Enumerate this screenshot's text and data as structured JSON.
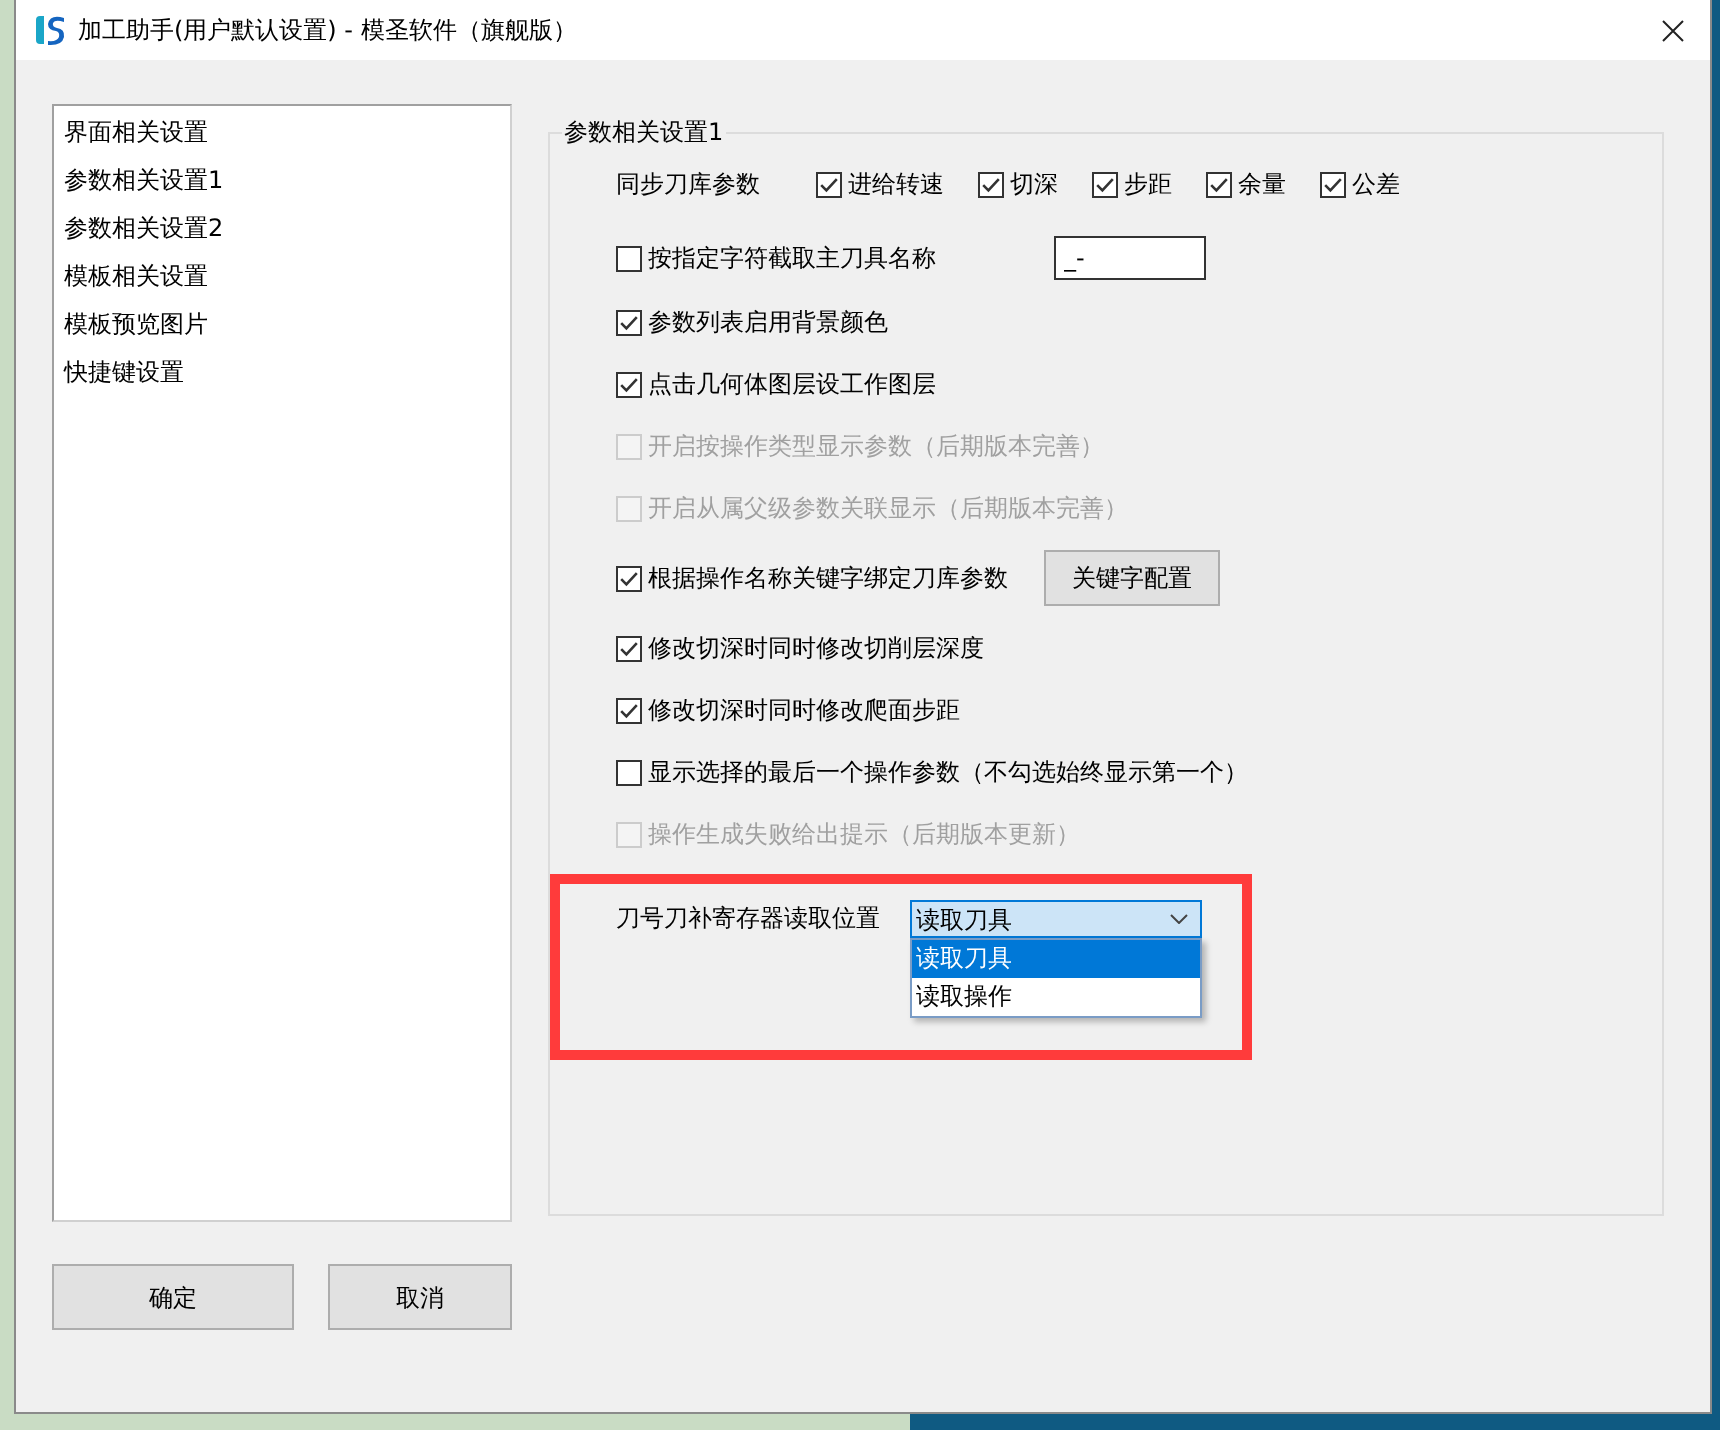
{
  "window": {
    "title": "加工助手(用户默认设置) - 模圣软件（旗舰版）"
  },
  "sidebar": {
    "items": [
      {
        "label": "界面相关设置",
        "selected": false
      },
      {
        "label": "参数相关设置1",
        "selected": false
      },
      {
        "label": "参数相关设置2",
        "selected": false
      },
      {
        "label": "模板相关设置",
        "selected": false
      },
      {
        "label": "模板预览图片",
        "selected": false
      },
      {
        "label": "快捷键设置",
        "selected": false
      }
    ]
  },
  "panel": {
    "title": "参数相关设置1",
    "sync": {
      "label": "同步刀库参数",
      "options": [
        {
          "label": "进给转速",
          "checked": true
        },
        {
          "label": "切深",
          "checked": true
        },
        {
          "label": "步距",
          "checked": true
        },
        {
          "label": "余量",
          "checked": true
        },
        {
          "label": "公差",
          "checked": true
        }
      ]
    },
    "options": [
      {
        "kind": "input",
        "label": "按指定字符截取主刀具名称",
        "checked": false,
        "disabled": false,
        "value": "_-"
      },
      {
        "kind": "plain",
        "label": "参数列表启用背景颜色",
        "checked": true,
        "disabled": false
      },
      {
        "kind": "plain",
        "label": "点击几何体图层设工作图层",
        "checked": true,
        "disabled": false
      },
      {
        "kind": "plain",
        "label": "开启按操作类型显示参数（后期版本完善）",
        "checked": false,
        "disabled": true
      },
      {
        "kind": "plain",
        "label": "开启从属父级参数关联显示（后期版本完善）",
        "checked": false,
        "disabled": true
      },
      {
        "kind": "button",
        "label": "根据操作名称关键字绑定刀库参数",
        "checked": true,
        "disabled": false,
        "button": "关键字配置"
      },
      {
        "kind": "plain",
        "label": "修改切深时同时修改切削层深度",
        "checked": true,
        "disabled": false
      },
      {
        "kind": "plain",
        "label": "修改切深时同时修改爬面步距",
        "checked": true,
        "disabled": false
      },
      {
        "kind": "plain",
        "label": "显示选择的最后一个操作参数（不勾选始终显示第一个）",
        "checked": false,
        "disabled": false
      },
      {
        "kind": "plain",
        "label": "操作生成失败给出提示（后期版本更新）",
        "checked": false,
        "disabled": true
      }
    ],
    "register": {
      "label": "刀号刀补寄存器读取位置",
      "value": "读取刀具",
      "expanded": true,
      "highlighted": true,
      "options": [
        {
          "label": "读取刀具",
          "selected": true
        },
        {
          "label": "读取操作",
          "selected": false
        }
      ]
    }
  },
  "buttons": [
    {
      "label": "确定"
    },
    {
      "label": "取消"
    }
  ]
}
